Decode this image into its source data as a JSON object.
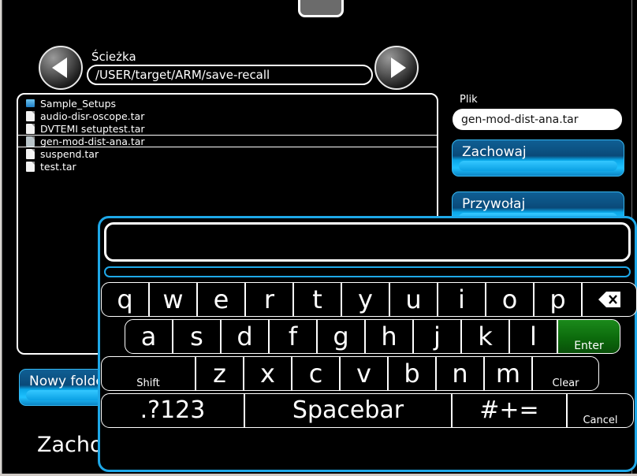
{
  "window": {
    "title": ""
  },
  "nav": {
    "back_icon": "triangle-left-icon",
    "forward_icon": "triangle-right-icon",
    "path_label": "Ścieżka",
    "path_value": "/USER/target/ARM/save-recall"
  },
  "file_browser": {
    "items": [
      {
        "name": "Sample_Setups",
        "type": "folder",
        "selected": false
      },
      {
        "name": "audio-disr-oscope.tar",
        "type": "file",
        "selected": false
      },
      {
        "name": "DVTEMI setuptest.tar",
        "type": "file",
        "selected": false
      },
      {
        "name": "gen-mod-dist-ana.tar",
        "type": "file",
        "selected": true
      },
      {
        "name": "suspend.tar",
        "type": "file",
        "selected": false
      },
      {
        "name": "test.tar",
        "type": "file",
        "selected": false
      }
    ]
  },
  "side_panel": {
    "file_label": "Plik",
    "file_value": "gen-mod-dist-ana.tar",
    "save_button": "Zachowaj",
    "recall_button": "Przywołaj"
  },
  "bottom": {
    "new_folder_button": "Nowy folder",
    "heading": "Zachowaj"
  },
  "keyboard": {
    "input_value": "",
    "input_placeholder": "",
    "row1": [
      "q",
      "w",
      "e",
      "r",
      "t",
      "y",
      "u",
      "i",
      "o",
      "p"
    ],
    "row1_extra": {
      "label": "",
      "icon": "backspace-icon"
    },
    "row2": [
      "a",
      "s",
      "d",
      "f",
      "g",
      "h",
      "j",
      "k",
      "l"
    ],
    "row2_extra": {
      "label": "Enter",
      "color": "#0f7a0f"
    },
    "row3_left": {
      "label": "Shift"
    },
    "row3": [
      "z",
      "x",
      "c",
      "v",
      "b",
      "n",
      "m"
    ],
    "row3_right": {
      "label": "Clear"
    },
    "row4": {
      "numeric": ".?123",
      "space": "Spacebar",
      "symbols": "#+=",
      "cancel": "Cancel"
    }
  },
  "colors": {
    "accent_cyan": "#1ea8e8",
    "button_blue": "#0aa7e8",
    "enter_green": "#0f7a0f",
    "background": "#000000"
  }
}
